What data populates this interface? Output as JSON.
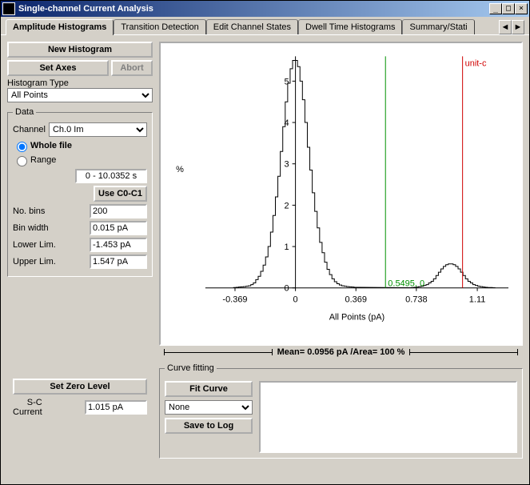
{
  "window": {
    "title": "Single-channel Current Analysis"
  },
  "tabs": {
    "items": [
      "Amplitude Histograms",
      "Transition Detection",
      "Edit Channel States",
      "Dwell Time Histograms",
      "Summary/Stati"
    ],
    "active": 0
  },
  "left": {
    "new_histogram": "New Histogram",
    "set_axes": "Set Axes",
    "abort": "Abort",
    "histogram_type_label": "Histogram Type",
    "histogram_type_value": "All Points",
    "data_legend": "Data",
    "channel_label": "Channel",
    "channel_value": "Ch.0 Im",
    "whole_file": "Whole file",
    "range": "Range",
    "range_value": "0 - 10.0352 s",
    "use_cursors": "Use C0-C1",
    "no_bins_label": "No. bins",
    "no_bins_value": "200",
    "bin_width_label": "Bin width",
    "bin_width_value": "0.015 pA",
    "lower_lim_label": "Lower Lim.",
    "lower_lim_value": "-1.453 pA",
    "upper_lim_label": "Upper Lim.",
    "upper_lim_value": "1.547 pA",
    "set_zero_level": "Set Zero Level",
    "sc_current_label": "S-C",
    "sc_current_label2": "Current",
    "sc_current_value": "1.015 pA"
  },
  "chart": {
    "mean_text": "Mean= 0.0956 pA /Area= 100 %",
    "ylabel": "%",
    "xlabel": "All Points (pA)",
    "green_cursor_label": "0.5495, 0",
    "red_cursor_label": "unit-c"
  },
  "chart_data": {
    "type": "histogram",
    "xlabel": "All Points (pA)",
    "ylabel": "%",
    "xlim": [
      -0.55,
      1.3
    ],
    "ylim": [
      0,
      5.6
    ],
    "xticks": [
      -0.369,
      0,
      0.369,
      0.738,
      1.11
    ],
    "yticks": [
      0,
      1,
      2,
      3,
      4,
      5
    ],
    "cursors": [
      {
        "x": 0.5495,
        "y": 0,
        "color": "green",
        "label": "0.5495, 0"
      },
      {
        "x": 1.02,
        "color": "red",
        "label": "unit-c"
      }
    ],
    "bins": [
      {
        "x": -0.37,
        "pct": 0.01
      },
      {
        "x": -0.355,
        "pct": 0.015
      },
      {
        "x": -0.34,
        "pct": 0.02
      },
      {
        "x": -0.325,
        "pct": 0.025
      },
      {
        "x": -0.31,
        "pct": 0.03
      },
      {
        "x": -0.295,
        "pct": 0.04
      },
      {
        "x": -0.28,
        "pct": 0.05
      },
      {
        "x": -0.265,
        "pct": 0.08
      },
      {
        "x": -0.25,
        "pct": 0.12
      },
      {
        "x": -0.235,
        "pct": 0.2
      },
      {
        "x": -0.22,
        "pct": 0.28
      },
      {
        "x": -0.205,
        "pct": 0.4
      },
      {
        "x": -0.19,
        "pct": 0.55
      },
      {
        "x": -0.175,
        "pct": 0.75
      },
      {
        "x": -0.16,
        "pct": 1.0
      },
      {
        "x": -0.145,
        "pct": 1.35
      },
      {
        "x": -0.13,
        "pct": 1.75
      },
      {
        "x": -0.115,
        "pct": 2.2
      },
      {
        "x": -0.1,
        "pct": 2.7
      },
      {
        "x": -0.085,
        "pct": 3.3
      },
      {
        "x": -0.07,
        "pct": 3.9
      },
      {
        "x": -0.055,
        "pct": 4.5
      },
      {
        "x": -0.04,
        "pct": 4.95
      },
      {
        "x": -0.025,
        "pct": 5.3
      },
      {
        "x": -0.01,
        "pct": 5.5
      },
      {
        "x": 0.005,
        "pct": 5.5
      },
      {
        "x": 0.02,
        "pct": 5.35
      },
      {
        "x": 0.035,
        "pct": 5.0
      },
      {
        "x": 0.05,
        "pct": 4.55
      },
      {
        "x": 0.065,
        "pct": 4.0
      },
      {
        "x": 0.08,
        "pct": 3.4
      },
      {
        "x": 0.095,
        "pct": 2.85
      },
      {
        "x": 0.11,
        "pct": 2.3
      },
      {
        "x": 0.125,
        "pct": 1.85
      },
      {
        "x": 0.14,
        "pct": 1.45
      },
      {
        "x": 0.155,
        "pct": 1.1
      },
      {
        "x": 0.17,
        "pct": 0.85
      },
      {
        "x": 0.185,
        "pct": 0.62
      },
      {
        "x": 0.2,
        "pct": 0.45
      },
      {
        "x": 0.215,
        "pct": 0.32
      },
      {
        "x": 0.23,
        "pct": 0.22
      },
      {
        "x": 0.245,
        "pct": 0.15
      },
      {
        "x": 0.26,
        "pct": 0.1
      },
      {
        "x": 0.275,
        "pct": 0.07
      },
      {
        "x": 0.29,
        "pct": 0.05
      },
      {
        "x": 0.305,
        "pct": 0.04
      },
      {
        "x": 0.32,
        "pct": 0.03
      },
      {
        "x": 0.335,
        "pct": 0.025
      },
      {
        "x": 0.35,
        "pct": 0.02
      },
      {
        "x": 0.365,
        "pct": 0.015
      },
      {
        "x": 0.38,
        "pct": 0.015
      },
      {
        "x": 0.7,
        "pct": 0.005
      },
      {
        "x": 0.715,
        "pct": 0.01
      },
      {
        "x": 0.73,
        "pct": 0.015
      },
      {
        "x": 0.745,
        "pct": 0.02
      },
      {
        "x": 0.76,
        "pct": 0.03
      },
      {
        "x": 0.775,
        "pct": 0.04
      },
      {
        "x": 0.79,
        "pct": 0.06
      },
      {
        "x": 0.805,
        "pct": 0.08
      },
      {
        "x": 0.82,
        "pct": 0.12
      },
      {
        "x": 0.835,
        "pct": 0.16
      },
      {
        "x": 0.85,
        "pct": 0.22
      },
      {
        "x": 0.865,
        "pct": 0.3
      },
      {
        "x": 0.88,
        "pct": 0.38
      },
      {
        "x": 0.895,
        "pct": 0.46
      },
      {
        "x": 0.91,
        "pct": 0.52
      },
      {
        "x": 0.925,
        "pct": 0.56
      },
      {
        "x": 0.94,
        "pct": 0.58
      },
      {
        "x": 0.955,
        "pct": 0.58
      },
      {
        "x": 0.97,
        "pct": 0.56
      },
      {
        "x": 0.985,
        "pct": 0.52
      },
      {
        "x": 1.0,
        "pct": 0.46
      },
      {
        "x": 1.015,
        "pct": 0.38
      },
      {
        "x": 1.03,
        "pct": 0.3
      },
      {
        "x": 1.045,
        "pct": 0.22
      },
      {
        "x": 1.06,
        "pct": 0.16
      },
      {
        "x": 1.075,
        "pct": 0.12
      },
      {
        "x": 1.09,
        "pct": 0.08
      },
      {
        "x": 1.105,
        "pct": 0.06
      },
      {
        "x": 1.12,
        "pct": 0.04
      },
      {
        "x": 1.135,
        "pct": 0.03
      },
      {
        "x": 1.15,
        "pct": 0.02
      },
      {
        "x": 1.165,
        "pct": 0.015
      },
      {
        "x": 1.18,
        "pct": 0.01
      },
      {
        "x": 1.195,
        "pct": 0.008
      },
      {
        "x": 1.21,
        "pct": 0.005
      }
    ]
  },
  "curve": {
    "legend": "Curve fitting",
    "fit_curve": "Fit Curve",
    "type_value": "None",
    "save_to_log": "Save to Log"
  }
}
